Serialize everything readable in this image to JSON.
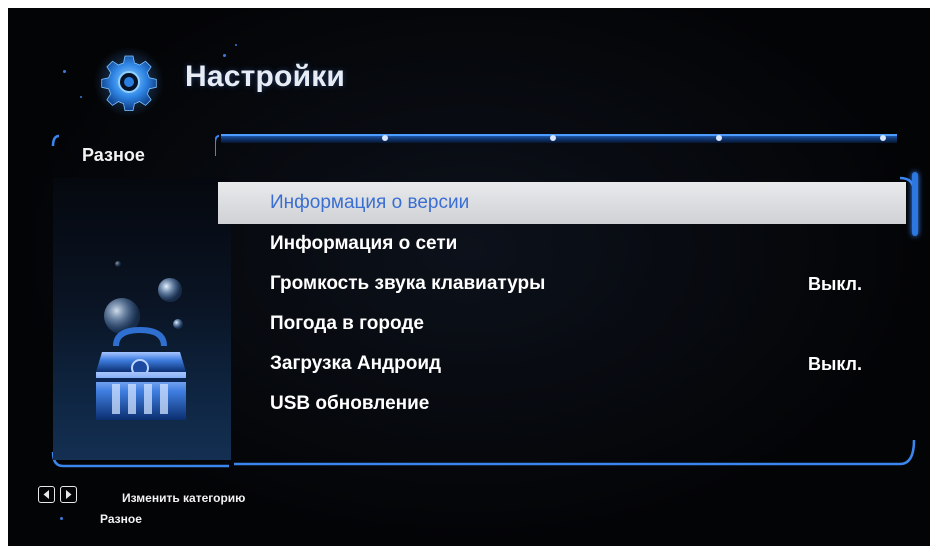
{
  "header": {
    "title": "Настройки",
    "icon": "gear-icon"
  },
  "category": {
    "name": "Разное"
  },
  "menu": {
    "items": [
      {
        "label": "Информация о версии",
        "value": "",
        "selected": true
      },
      {
        "label": "Информация о сети",
        "value": ""
      },
      {
        "label": "Громкость звука клавиатуры",
        "value": "Выкл."
      },
      {
        "label": "Погода в городе",
        "value": ""
      },
      {
        "label": "Загрузка Андроид",
        "value": "Выкл."
      },
      {
        "label": "USB обновление",
        "value": ""
      }
    ]
  },
  "footer": {
    "hint": "Изменить категорию",
    "current_category": "Разное",
    "left_key_icon": "arrow-left-key-icon",
    "right_key_icon": "arrow-right-key-icon"
  },
  "colors": {
    "background": "#030406",
    "accent": "#2d78e0",
    "selected_row": "#dcdde0",
    "selected_text": "#3a6fd1",
    "text": "#ffffff"
  }
}
